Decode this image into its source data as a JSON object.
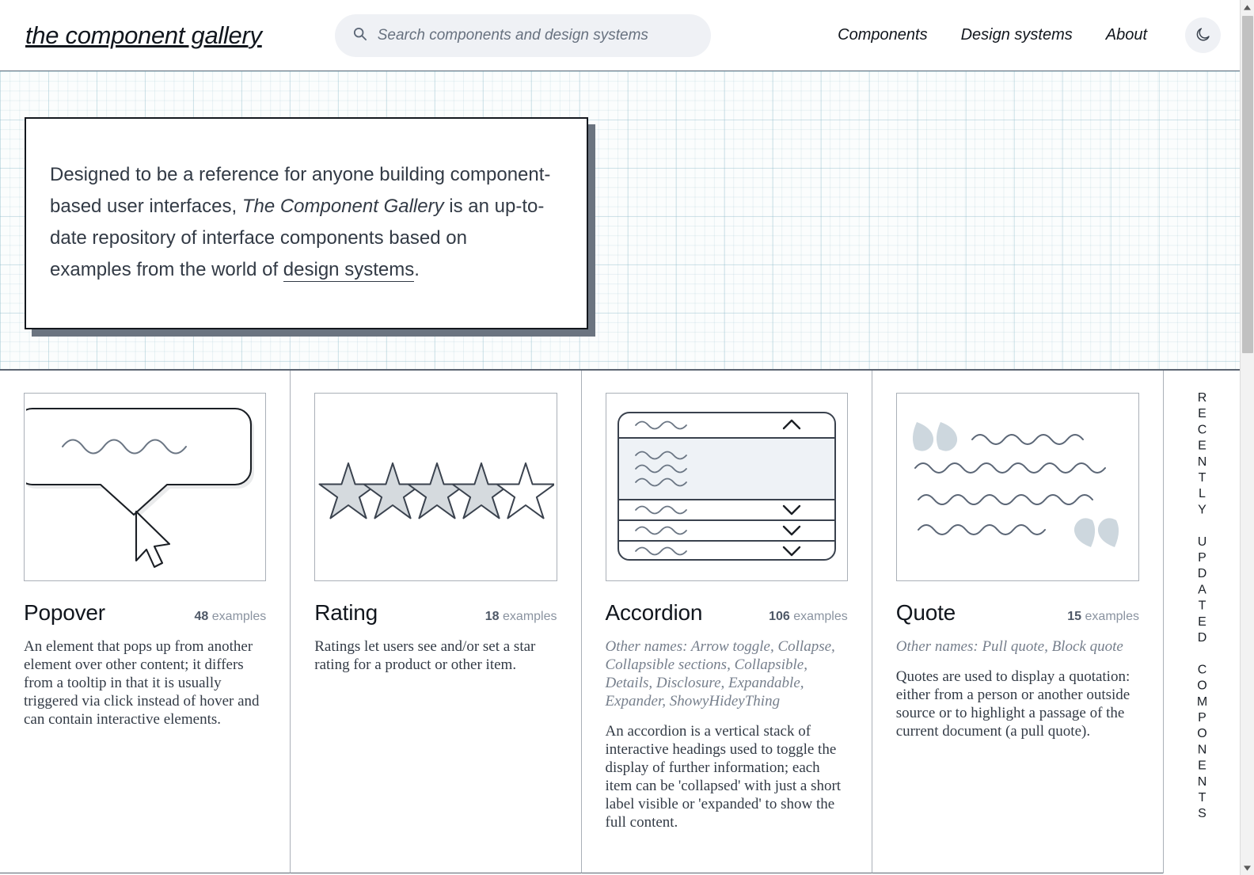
{
  "header": {
    "logo": "the component gallery",
    "search": {
      "placeholder": "Search components and design systems",
      "value": "",
      "icon": "search-icon"
    },
    "nav": [
      {
        "label": "Components"
      },
      {
        "label": "Design systems"
      },
      {
        "label": "About"
      }
    ],
    "theme_toggle": {
      "icon": "moon-icon",
      "label": ""
    }
  },
  "hero": {
    "text_part1": "Designed to be a reference for anyone building component-based user interfaces, ",
    "emphasis": "The Component Gallery",
    "text_part2": " is an up-to-date repository of interface components based on examples from the world of ",
    "link": "design systems",
    "text_part3": "."
  },
  "rail": {
    "label": "RECENTLY UPDATED COMPONENTS"
  },
  "cards": [
    {
      "title": "Popover",
      "count": "48",
      "count_unit": "examples",
      "aliases": "",
      "description": "An element that pops up from another element over other content; it differs from a tooltip in that it is usually triggered via click instead of hover and can contain interactive elements.",
      "thumb": "popover-illustration"
    },
    {
      "title": "Rating",
      "count": "18",
      "count_unit": "examples",
      "aliases": "",
      "description": "Ratings let users see and/or set a star rating for a product or other item.",
      "thumb": "rating-illustration"
    },
    {
      "title": "Accordion",
      "count": "106",
      "count_unit": "examples",
      "aliases": "Other names: Arrow toggle, Collapse, Collapsible sections, Collapsible, Details, Disclosure, Expandable, Expander, ShowyHideyThing",
      "description": "An accordion is a vertical stack of interactive headings used to toggle the display of further information; each item can be 'collapsed' with just a short label visible or 'expanded' to show the full content.",
      "thumb": "accordion-illustration"
    },
    {
      "title": "Quote",
      "count": "15",
      "count_unit": "examples",
      "aliases": "Other names: Pull quote, Block quote",
      "description": "Quotes are used to display a quotation: either from a person or another outside source or to highlight a passage of the current document (a pull quote).",
      "thumb": "quote-illustration"
    }
  ],
  "colors": {
    "accent_line": "#5b6471",
    "grid_line": "#aab0b8",
    "muted_text": "#8a93a0",
    "body_text": "#333b46",
    "search_bg": "#eff1f5",
    "shadow": "#6b7480"
  },
  "rating_stars": {
    "filled": 4,
    "empty": 1
  }
}
